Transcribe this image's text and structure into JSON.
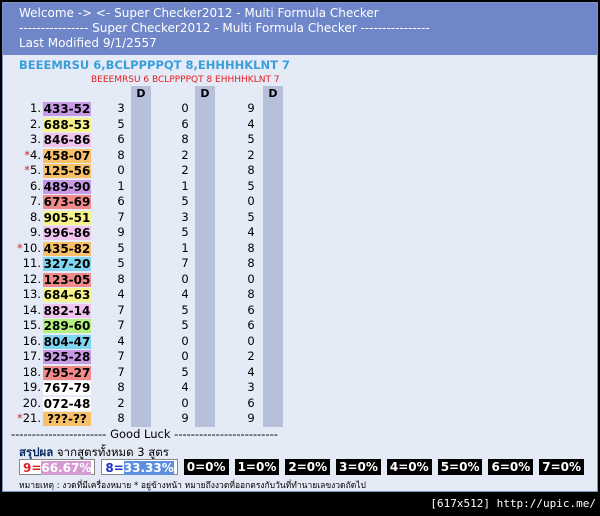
{
  "header": {
    "line1": "Welcome -> <- Super Checker2012 - Multi Formula Checker",
    "line2": "---------------- Super Checker2012 - Multi Formula Checker ----------------",
    "line3": "Last Modified 9/1/2557"
  },
  "formula_title": "BEEEMRSU 6,BCLPPPPQT 8,EHHHHKLNT 7",
  "subtitle": "BEEEMRSU 6  BCLPPPPQT 8  EHHHHKLNT 7",
  "d_label": "D",
  "rows": [
    {
      "n": "1.",
      "star": "",
      "num": "433-52",
      "color": "#c79ae6",
      "v": [
        "3",
        "0",
        "9"
      ]
    },
    {
      "n": "2.",
      "star": "",
      "num": "688-53",
      "color": "#f7f28a",
      "v": [
        "5",
        "6",
        "4"
      ]
    },
    {
      "n": "3.",
      "star": "",
      "num": "846-86",
      "color": "#f0c4ef",
      "v": [
        "6",
        "8",
        "5"
      ]
    },
    {
      "n": "4.",
      "star": "*",
      "num": "458-07",
      "color": "#f9c06a",
      "v": [
        "8",
        "2",
        "2"
      ]
    },
    {
      "n": "5.",
      "star": "*",
      "num": "125-56",
      "color": "#f9c06a",
      "v": [
        "0",
        "2",
        "8"
      ]
    },
    {
      "n": "6.",
      "star": "",
      "num": "489-90",
      "color": "#c79ae6",
      "v": [
        "1",
        "1",
        "5"
      ]
    },
    {
      "n": "7.",
      "star": "",
      "num": "673-69",
      "color": "#f28a8a",
      "v": [
        "6",
        "5",
        "0"
      ]
    },
    {
      "n": "8.",
      "star": "",
      "num": "905-51",
      "color": "#f7f28a",
      "v": [
        "7",
        "3",
        "5"
      ]
    },
    {
      "n": "9.",
      "star": "",
      "num": "996-86",
      "color": "#f0c4ef",
      "v": [
        "9",
        "5",
        "4"
      ]
    },
    {
      "n": "10.",
      "star": "*",
      "num": "435-82",
      "color": "#f9c06a",
      "v": [
        "5",
        "1",
        "8"
      ]
    },
    {
      "n": "11.",
      "star": "",
      "num": "327-20",
      "color": "#7ed6f0",
      "v": [
        "5",
        "7",
        "8"
      ]
    },
    {
      "n": "12.",
      "star": "",
      "num": "123-05",
      "color": "#f28a8a",
      "v": [
        "8",
        "0",
        "0"
      ]
    },
    {
      "n": "13.",
      "star": "",
      "num": "684-63",
      "color": "#f7f28a",
      "v": [
        "4",
        "4",
        "8"
      ]
    },
    {
      "n": "14.",
      "star": "",
      "num": "882-14",
      "color": "#f0c4ef",
      "v": [
        "7",
        "5",
        "6"
      ]
    },
    {
      "n": "15.",
      "star": "",
      "num": "289-60",
      "color": "#b3f07e",
      "v": [
        "7",
        "5",
        "6"
      ]
    },
    {
      "n": "16.",
      "star": "",
      "num": "804-47",
      "color": "#7ed6f0",
      "v": [
        "4",
        "0",
        "0"
      ]
    },
    {
      "n": "17.",
      "star": "",
      "num": "925-28",
      "color": "#c79ae6",
      "v": [
        "7",
        "0",
        "2"
      ]
    },
    {
      "n": "18.",
      "star": "",
      "num": "795-27",
      "color": "#f28a8a",
      "v": [
        "7",
        "5",
        "4"
      ]
    },
    {
      "n": "19.",
      "star": "",
      "num": "767-79",
      "color": "#ffffff",
      "v": [
        "8",
        "4",
        "3"
      ]
    },
    {
      "n": "20.",
      "star": "",
      "num": "072-48",
      "color": "#ffffff",
      "v": [
        "2",
        "0",
        "6"
      ]
    },
    {
      "n": "21.",
      "star": "*",
      "num": "???-??",
      "color": "#f9c06a",
      "v": [
        "8",
        "9",
        "9"
      ]
    }
  ],
  "good_luck": "----------------------- Good Luck -------------------------",
  "summary": {
    "title_bold": "สรุปผล",
    "title_rest": " จากสูตรทั้งหมด 3 สูตร",
    "box1_n": "9=",
    "box1_pct": "66.67%",
    "box2_n": "8=",
    "box2_pct": "33.33%",
    "others": [
      "0=0%",
      "1=0%",
      "2=0%",
      "3=0%",
      "4=0%",
      "5=0%",
      "6=0%",
      "7=0%"
    ]
  },
  "note": "หมายเหตุ : งวดที่มีเครื่องหมาย * อยู่ข้างหน้า หมายถึงงวดที่ออกตรงกับวันที่ทำนายเลขงวดถัดไป",
  "footer": "[617x512] http://upic.me/"
}
